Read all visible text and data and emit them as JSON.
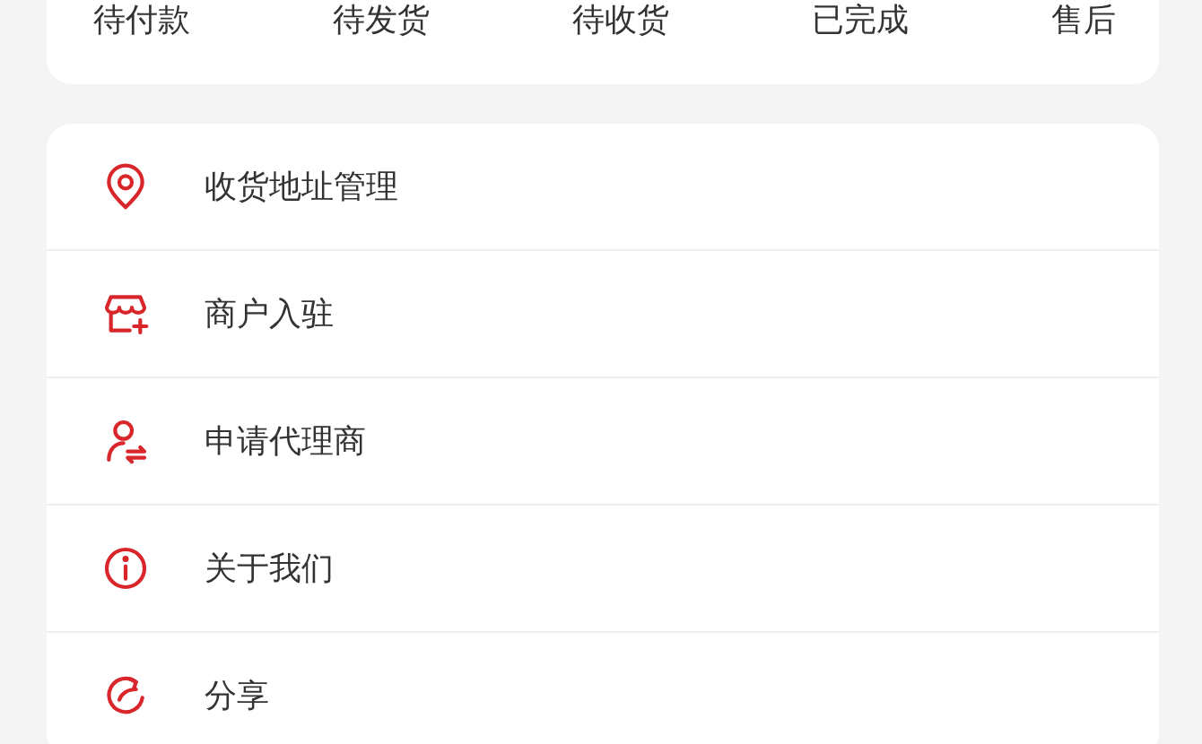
{
  "order_tabs": [
    {
      "label": "待付款"
    },
    {
      "label": "待发货"
    },
    {
      "label": "待收货"
    },
    {
      "label": "已完成"
    },
    {
      "label": "售后"
    }
  ],
  "menu": [
    {
      "kind": "location",
      "label": "收货地址管理"
    },
    {
      "kind": "store",
      "label": "商户入驻"
    },
    {
      "kind": "agent",
      "label": "申请代理商"
    },
    {
      "kind": "info",
      "label": "关于我们"
    },
    {
      "kind": "share",
      "label": "分享"
    }
  ]
}
